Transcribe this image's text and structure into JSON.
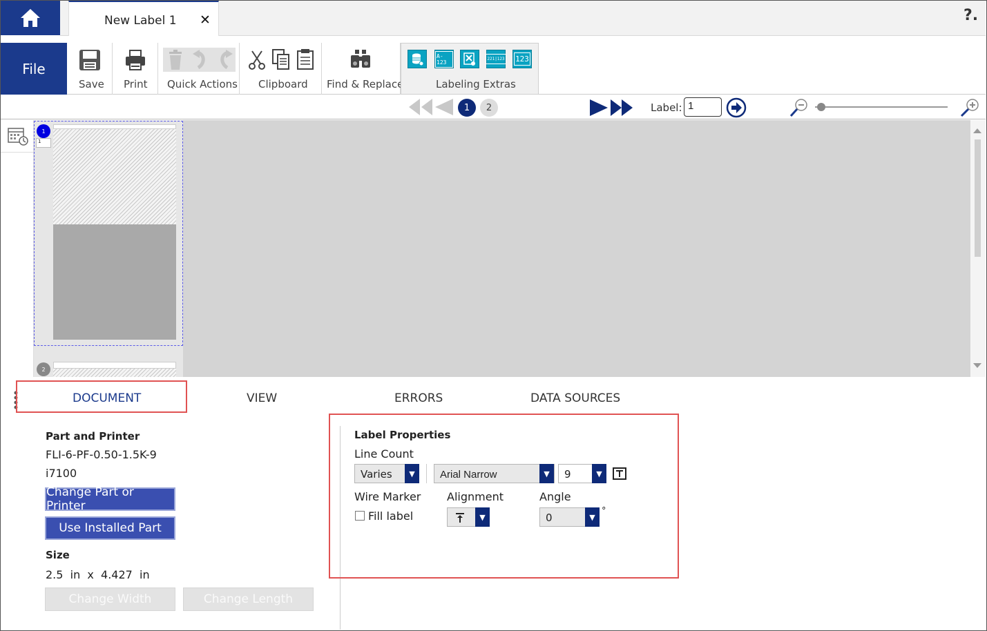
{
  "window": {
    "tab_title": "New Label 1",
    "tab_close": "✕",
    "help": "?."
  },
  "ribbon": {
    "file": "File",
    "save": "Save",
    "print": "Print",
    "quick_actions": "Quick Actions",
    "clipboard": "Clipboard",
    "find_replace": "Find & Replace",
    "labeling_extras": "Labeling Extras",
    "labeling_extras_icons": [
      "",
      "A-123",
      "",
      "221|123",
      "123"
    ]
  },
  "navbar": {
    "pages": [
      "1",
      "2"
    ],
    "label_prefix": "Label:",
    "label_value": "1"
  },
  "canvas": {
    "page_badges": [
      "1",
      "2"
    ],
    "row_number": "1"
  },
  "bottom_tabs": {
    "document": "DOCUMENT",
    "view": "VIEW",
    "errors": "ERRORS",
    "data_sources": "DATA SOURCES"
  },
  "document_panel": {
    "part_printer_heading": "Part and Printer",
    "part_number": "FLI-6-PF-0.50-1.5K-9",
    "printer": "i7100",
    "change_part_button": "Change Part or Printer",
    "use_installed_button": "Use Installed Part",
    "size_heading": "Size",
    "size_value": "2.5  in  x  4.427  in",
    "change_width_button": "Change Width",
    "change_length_button": "Change Length"
  },
  "label_properties": {
    "heading": "Label Properties",
    "line_count_label": "Line Count",
    "line_count_value": "Varies",
    "font_value": "Arial Narrow",
    "font_size_value": "9",
    "wire_marker_label": "Wire Marker",
    "fill_label": "Fill label",
    "fill_label_checked": false,
    "alignment_label": "Alignment",
    "angle_label": "Angle",
    "angle_value": "0",
    "degree_symbol": "°"
  },
  "colors": {
    "brand_blue": "#1b3a8c",
    "accent_cyan": "#0aa3c2",
    "highlight_red": "#e05252"
  }
}
